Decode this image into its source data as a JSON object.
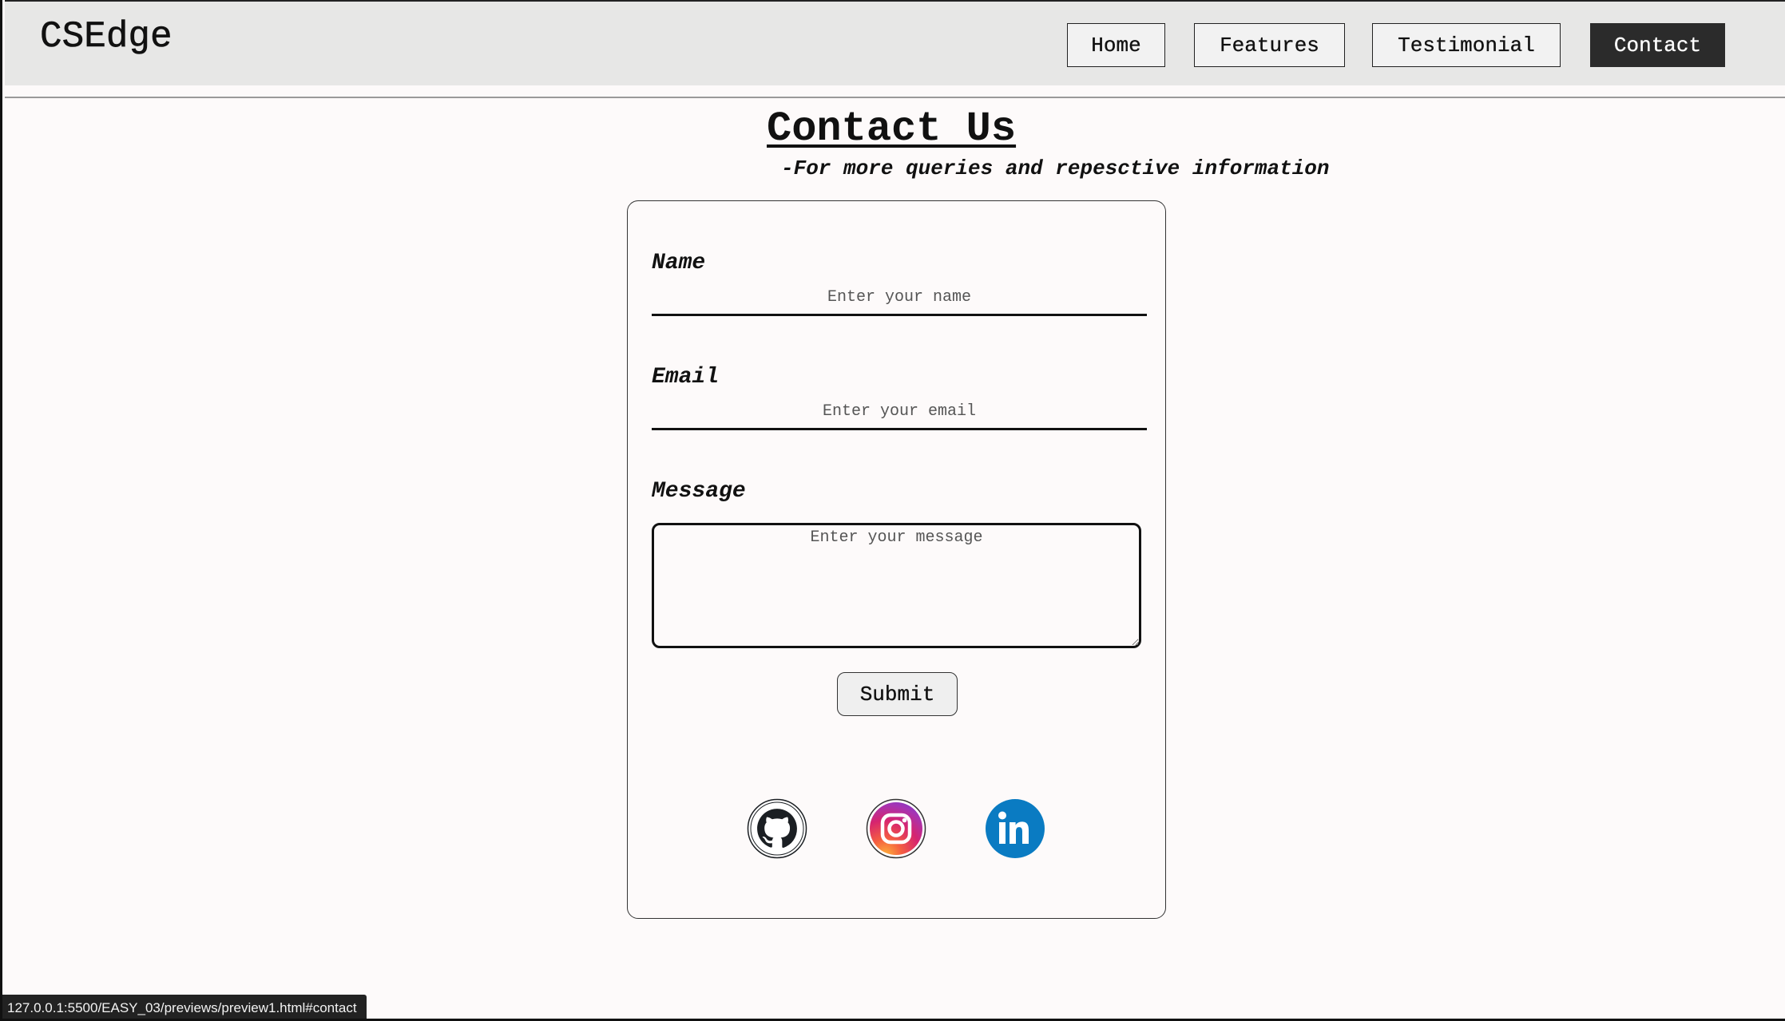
{
  "brand": {
    "name": "CSEdge"
  },
  "nav": {
    "items": [
      {
        "label": "Home",
        "active": false
      },
      {
        "label": "Features",
        "active": false
      },
      {
        "label": "Testimonial",
        "active": false
      },
      {
        "label": "Contact",
        "active": true
      }
    ]
  },
  "contact": {
    "title": "Contact Us",
    "subtitle": "-For more queries and repesctive information",
    "form": {
      "name_label": "Name",
      "name_placeholder": "Enter your name",
      "name_value": "",
      "email_label": "Email",
      "email_placeholder": "Enter your email",
      "email_value": "",
      "message_label": "Message",
      "message_placeholder": "Enter your message",
      "message_value": "",
      "submit_label": "Submit"
    },
    "social": [
      {
        "icon": "github-icon",
        "color": "#1b1f23"
      },
      {
        "icon": "instagram-icon",
        "color": "#c13584"
      },
      {
        "icon": "linkedin-icon",
        "color": "#0a7bc2"
      }
    ]
  },
  "status_bar": {
    "url": "127.0.0.1:5500/EASY_03/previews/preview1.html#contact"
  }
}
